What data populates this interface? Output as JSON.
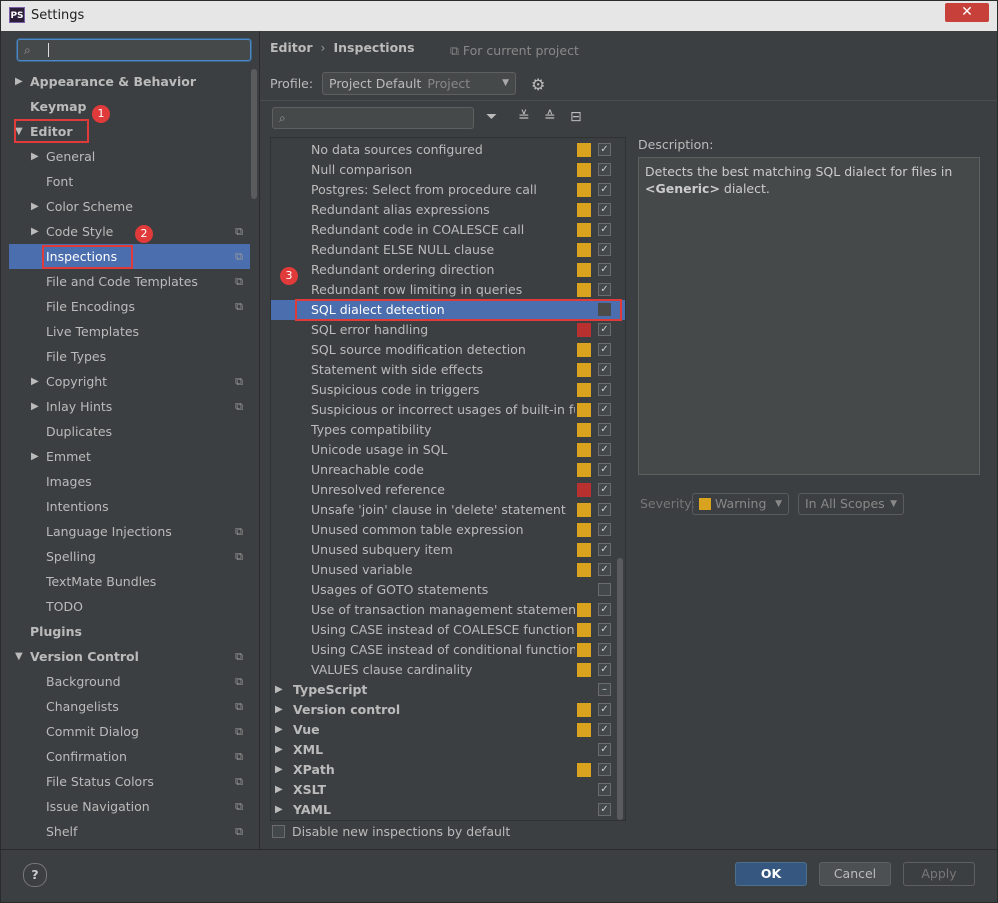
{
  "window": {
    "title": "Settings",
    "app_icon": "PS",
    "close_glyph": "✕"
  },
  "search": {
    "value": ""
  },
  "tree": [
    {
      "label": "Appearance & Behavior",
      "arrow": "▶",
      "level": 0,
      "bold": true
    },
    {
      "label": "Keymap",
      "arrow": "",
      "level": 0,
      "bold": true
    },
    {
      "label": "Editor",
      "arrow": "▼",
      "level": 0,
      "bold": true
    },
    {
      "label": "General",
      "arrow": "▶",
      "level": 1
    },
    {
      "label": "Font",
      "arrow": "",
      "level": 1
    },
    {
      "label": "Color Scheme",
      "arrow": "▶",
      "level": 1
    },
    {
      "label": "Code Style",
      "arrow": "▶",
      "level": 1,
      "copy": true
    },
    {
      "label": "Inspections",
      "arrow": "",
      "level": 1,
      "copy": true,
      "selected": true
    },
    {
      "label": "File and Code Templates",
      "arrow": "",
      "level": 1,
      "copy": true
    },
    {
      "label": "File Encodings",
      "arrow": "",
      "level": 1,
      "copy": true
    },
    {
      "label": "Live Templates",
      "arrow": "",
      "level": 1
    },
    {
      "label": "File Types",
      "arrow": "",
      "level": 1
    },
    {
      "label": "Copyright",
      "arrow": "▶",
      "level": 1,
      "copy": true
    },
    {
      "label": "Inlay Hints",
      "arrow": "▶",
      "level": 1,
      "copy": true
    },
    {
      "label": "Duplicates",
      "arrow": "",
      "level": 1
    },
    {
      "label": "Emmet",
      "arrow": "▶",
      "level": 1
    },
    {
      "label": "Images",
      "arrow": "",
      "level": 1
    },
    {
      "label": "Intentions",
      "arrow": "",
      "level": 1
    },
    {
      "label": "Language Injections",
      "arrow": "",
      "level": 1,
      "copy": true
    },
    {
      "label": "Spelling",
      "arrow": "",
      "level": 1,
      "copy": true
    },
    {
      "label": "TextMate Bundles",
      "arrow": "",
      "level": 1
    },
    {
      "label": "TODO",
      "arrow": "",
      "level": 1
    },
    {
      "label": "Plugins",
      "arrow": "",
      "level": 0,
      "bold": true
    },
    {
      "label": "Version Control",
      "arrow": "▼",
      "level": 0,
      "bold": true,
      "copy": true
    },
    {
      "label": "Background",
      "arrow": "",
      "level": 1,
      "copy": true
    },
    {
      "label": "Changelists",
      "arrow": "",
      "level": 1,
      "copy": true
    },
    {
      "label": "Commit Dialog",
      "arrow": "",
      "level": 1,
      "copy": true
    },
    {
      "label": "Confirmation",
      "arrow": "",
      "level": 1,
      "copy": true
    },
    {
      "label": "File Status Colors",
      "arrow": "",
      "level": 1,
      "copy": true
    },
    {
      "label": "Issue Navigation",
      "arrow": "",
      "level": 1,
      "copy": true
    },
    {
      "label": "Shelf",
      "arrow": "",
      "level": 1,
      "copy": true
    }
  ],
  "copy_glyph": "⧉",
  "breadcrumb": {
    "parent": "Editor",
    "sep": "›",
    "current": "Inspections"
  },
  "for_project": "⧉ For current project",
  "profile": {
    "label": "Profile:",
    "name": "Project Default",
    "scope": "Project"
  },
  "colors": {
    "warning": "#d9a320",
    "error": "#b8302f",
    "accent": "#4b6eaf"
  },
  "inspections": [
    {
      "label": "No data sources configured",
      "sev": "warning",
      "checked": true
    },
    {
      "label": "Null comparison",
      "sev": "warning",
      "checked": true
    },
    {
      "label": "Postgres: Select from procedure call",
      "sev": "warning",
      "checked": true
    },
    {
      "label": "Redundant alias expressions",
      "sev": "warning",
      "checked": true
    },
    {
      "label": "Redundant code in COALESCE call",
      "sev": "warning",
      "checked": true
    },
    {
      "label": "Redundant ELSE NULL clause",
      "sev": "warning",
      "checked": true
    },
    {
      "label": "Redundant ordering direction",
      "sev": "warning",
      "checked": true
    },
    {
      "label": "Redundant row limiting in queries",
      "sev": "warning",
      "checked": true
    },
    {
      "label": "SQL dialect detection",
      "sev": "",
      "checked": false,
      "selected": true
    },
    {
      "label": "SQL error handling",
      "sev": "error",
      "checked": true
    },
    {
      "label": "SQL source modification detection",
      "sev": "warning",
      "checked": true
    },
    {
      "label": "Statement with side effects",
      "sev": "warning",
      "checked": true
    },
    {
      "label": "Suspicious code in triggers",
      "sev": "warning",
      "checked": true
    },
    {
      "label": "Suspicious or incorrect usages of built-in func",
      "sev": "warning",
      "checked": true
    },
    {
      "label": "Types compatibility",
      "sev": "warning",
      "checked": true
    },
    {
      "label": "Unicode usage in SQL",
      "sev": "warning",
      "checked": true
    },
    {
      "label": "Unreachable code",
      "sev": "warning",
      "checked": true
    },
    {
      "label": "Unresolved reference",
      "sev": "error",
      "checked": true
    },
    {
      "label": "Unsafe 'join' clause in 'delete' statement",
      "sev": "warning",
      "checked": true
    },
    {
      "label": "Unused common table expression",
      "sev": "warning",
      "checked": true
    },
    {
      "label": "Unused subquery item",
      "sev": "warning",
      "checked": true
    },
    {
      "label": "Unused variable",
      "sev": "warning",
      "checked": true
    },
    {
      "label": "Usages of GOTO statements",
      "sev": "",
      "checked": false
    },
    {
      "label": "Use of transaction management statements ir",
      "sev": "warning",
      "checked": true
    },
    {
      "label": "Using CASE instead of COALESCE function an",
      "sev": "warning",
      "checked": true
    },
    {
      "label": "Using CASE instead of conditional function ar",
      "sev": "warning",
      "checked": true
    },
    {
      "label": "VALUES clause cardinality",
      "sev": "warning",
      "checked": true
    },
    {
      "label": "TypeScript",
      "group": true,
      "sev": "",
      "checked": "mixed"
    },
    {
      "label": "Version control",
      "group": true,
      "sev": "warning",
      "checked": true
    },
    {
      "label": "Vue",
      "group": true,
      "sev": "warning",
      "checked": true
    },
    {
      "label": "XML",
      "group": true,
      "sev": "",
      "checked": true
    },
    {
      "label": "XPath",
      "group": true,
      "sev": "warning",
      "checked": true
    },
    {
      "label": "XSLT",
      "group": true,
      "sev": "",
      "checked": true
    },
    {
      "label": "YAML",
      "group": true,
      "sev": "",
      "checked": true
    }
  ],
  "disable_new": "Disable new inspections by default",
  "description": {
    "label": "Description:",
    "text_before": "Detects the best matching SQL dialect for files in ",
    "text_bold": "<Generic>",
    "text_after": " dialect."
  },
  "severity": {
    "label": "Severity:",
    "value": "Warning",
    "scope": "In All Scopes"
  },
  "buttons": {
    "ok": "OK",
    "cancel": "Cancel",
    "apply": "Apply",
    "help": "?"
  },
  "annotations": [
    "1",
    "2",
    "3"
  ],
  "glyphs": {
    "arrow_right": "▶",
    "arrow_down": "▼",
    "search": "⌕",
    "filter": "⏷",
    "expand": "≚",
    "collapse": "≙",
    "reset": "⊟",
    "gear": "⚙",
    "check": "✓",
    "dash": "–",
    "dropdown": "▼"
  }
}
